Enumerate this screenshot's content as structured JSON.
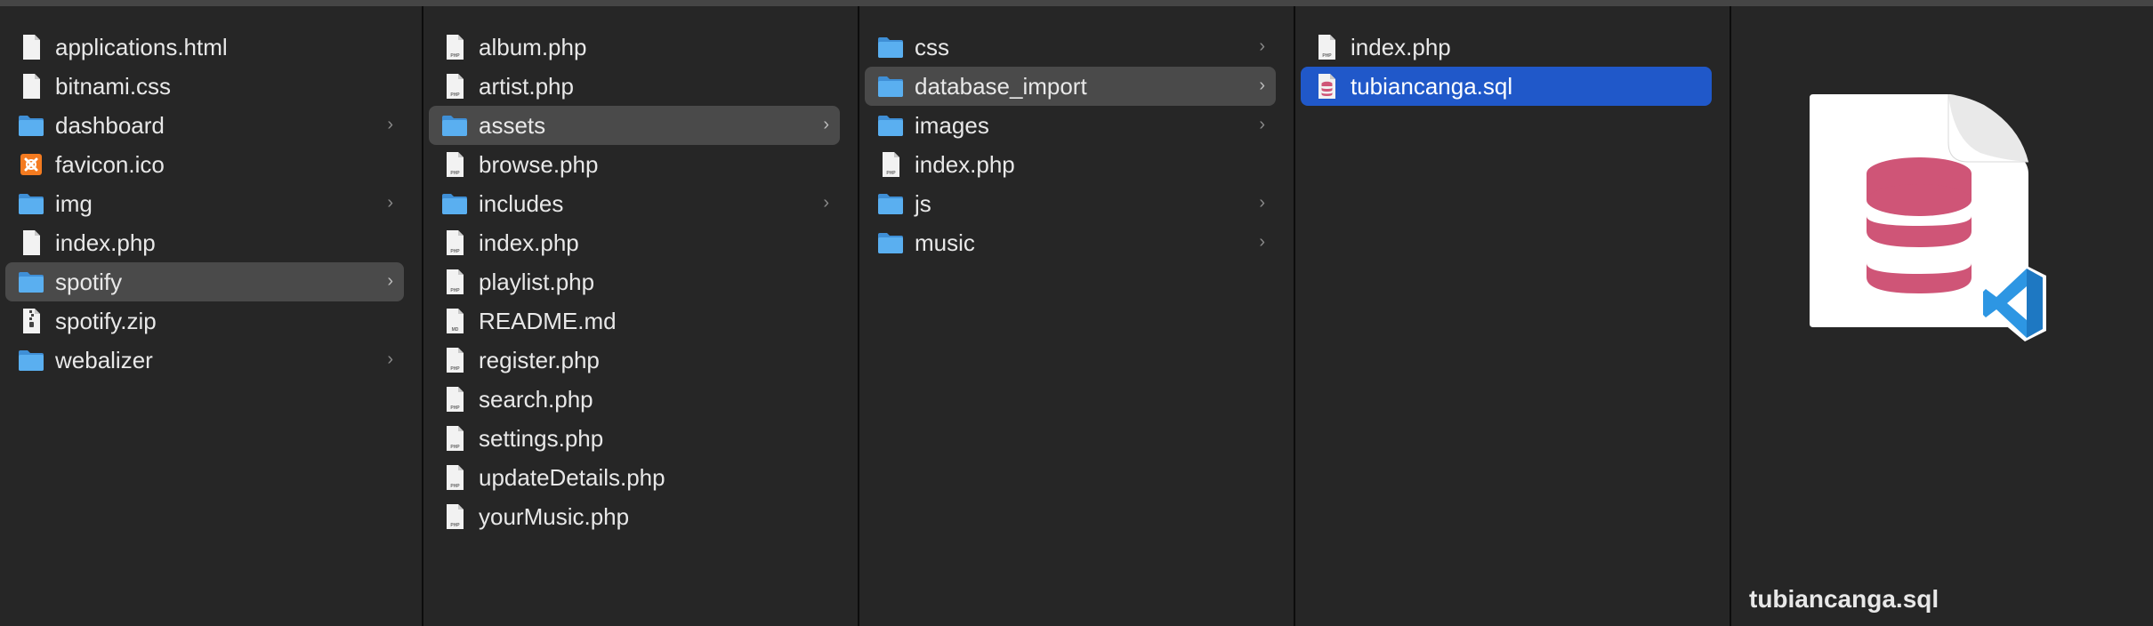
{
  "columns": [
    {
      "items": [
        {
          "label": "applications.html",
          "icon": "document-icon",
          "folder": false
        },
        {
          "label": "bitnami.css",
          "icon": "document-icon",
          "folder": false
        },
        {
          "label": "dashboard",
          "icon": "folder-icon",
          "folder": true
        },
        {
          "label": "favicon.ico",
          "icon": "xampp-icon",
          "folder": false
        },
        {
          "label": "img",
          "icon": "folder-icon",
          "folder": true
        },
        {
          "label": "index.php",
          "icon": "document-icon",
          "folder": false
        },
        {
          "label": "spotify",
          "icon": "folder-icon",
          "folder": true,
          "selected": "gray"
        },
        {
          "label": "spotify.zip",
          "icon": "zip-icon",
          "folder": false
        },
        {
          "label": "webalizer",
          "icon": "folder-icon",
          "folder": true
        }
      ]
    },
    {
      "items": [
        {
          "label": "album.php",
          "icon": "php-file-icon",
          "folder": false
        },
        {
          "label": "artist.php",
          "icon": "php-file-icon",
          "folder": false
        },
        {
          "label": "assets",
          "icon": "folder-icon",
          "folder": true,
          "selected": "gray"
        },
        {
          "label": "browse.php",
          "icon": "php-file-icon",
          "folder": false
        },
        {
          "label": "includes",
          "icon": "folder-icon",
          "folder": true
        },
        {
          "label": "index.php",
          "icon": "php-file-icon",
          "folder": false
        },
        {
          "label": "playlist.php",
          "icon": "php-file-icon",
          "folder": false
        },
        {
          "label": "README.md",
          "icon": "md-file-icon",
          "folder": false
        },
        {
          "label": "register.php",
          "icon": "php-file-icon",
          "folder": false
        },
        {
          "label": "search.php",
          "icon": "php-file-icon",
          "folder": false
        },
        {
          "label": "settings.php",
          "icon": "php-file-icon",
          "folder": false
        },
        {
          "label": "updateDetails.php",
          "icon": "php-file-icon",
          "folder": false
        },
        {
          "label": "yourMusic.php",
          "icon": "php-file-icon",
          "folder": false
        }
      ]
    },
    {
      "items": [
        {
          "label": "css",
          "icon": "folder-icon",
          "folder": true
        },
        {
          "label": "database_import",
          "icon": "folder-icon",
          "folder": true,
          "selected": "gray"
        },
        {
          "label": "images",
          "icon": "folder-icon",
          "folder": true
        },
        {
          "label": "index.php",
          "icon": "php-file-icon",
          "folder": false
        },
        {
          "label": "js",
          "icon": "folder-icon",
          "folder": true
        },
        {
          "label": "music",
          "icon": "folder-icon",
          "folder": true
        }
      ]
    },
    {
      "items": [
        {
          "label": "index.php",
          "icon": "php-file-icon",
          "folder": false
        },
        {
          "label": "tubiancanga.sql",
          "icon": "sql-file-icon",
          "folder": false,
          "selected": "blue"
        }
      ]
    }
  ],
  "chevron": "›",
  "preview": {
    "filename": "tubiancanga.sql",
    "icon": "sql-vscode-document-icon"
  },
  "colors": {
    "background": "#262626",
    "selection_blue": "#2058c9",
    "selection_gray": "#4a4a4a",
    "folder_blue": "#5aaff0",
    "database_pink": "#cf5577",
    "vscode_blue": "#2d8fd9"
  }
}
